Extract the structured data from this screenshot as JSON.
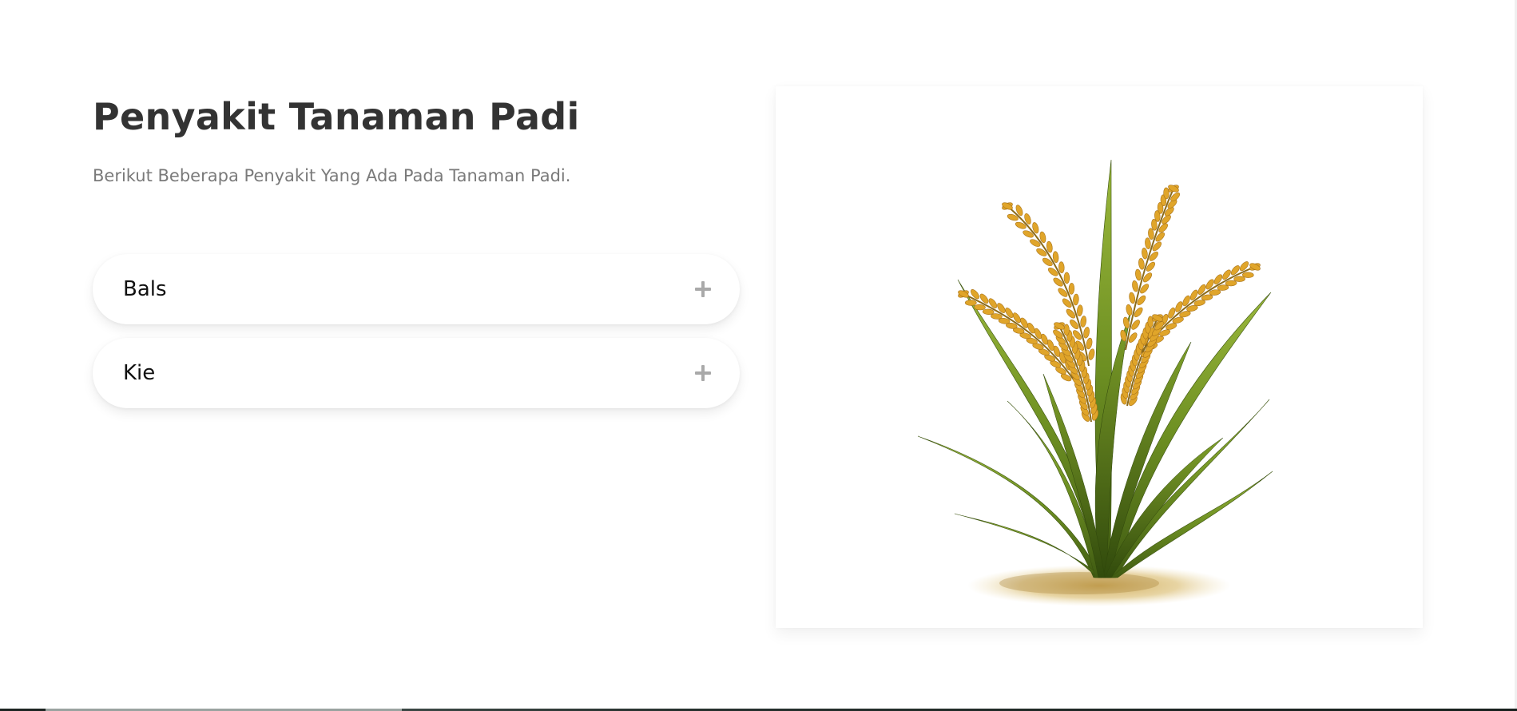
{
  "section": {
    "title": "Penyakit Tanaman Padi",
    "subtitle": "Berikut Beberapa Penyakit Yang Ada Pada Tanaman Padi."
  },
  "accordion": {
    "items": [
      {
        "label": "Bals",
        "icon": "plus-icon"
      },
      {
        "label": "Kie",
        "icon": "plus-icon"
      }
    ]
  },
  "image": {
    "subject": "rice-plant-illustration"
  },
  "colors": {
    "title": "#333333",
    "subtitle": "#7a7a7a",
    "plus_icon": "#a9a9a9",
    "grain": "#e0a52a",
    "leaf": "#6b8e1f"
  }
}
